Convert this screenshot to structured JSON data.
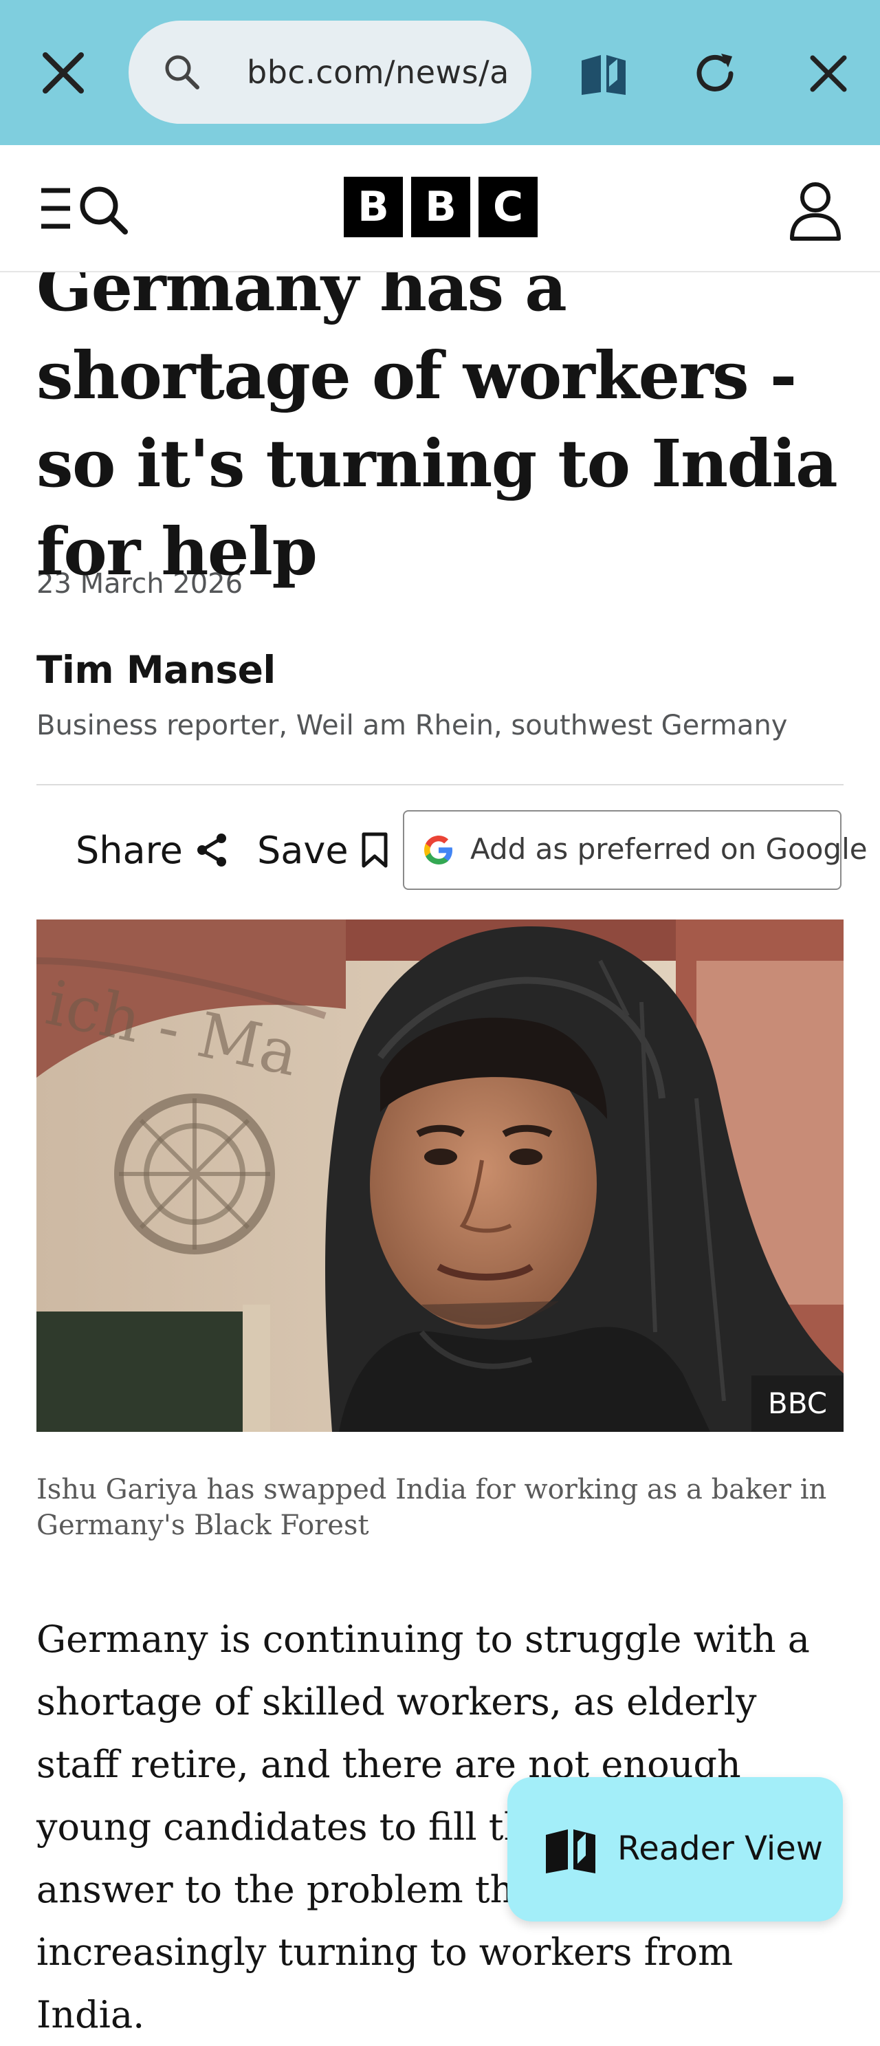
{
  "browser": {
    "url": "bbc.com/news/a",
    "icons": [
      "close-icon",
      "search-icon",
      "reader-mode-icon",
      "reload-icon",
      "close-icon"
    ]
  },
  "header": {
    "logo_letters": [
      "B",
      "B",
      "C"
    ],
    "icons": [
      "menu-search-icon",
      "account-icon"
    ]
  },
  "article": {
    "headline": "Germany has a shortage of workers - so it's turning to India for help",
    "date": "23 March 2026",
    "author": "Tim Mansel",
    "author_role": "Business reporter, Weil am Rhein, southwest Germany",
    "share_label": "Share",
    "save_label": "Save",
    "google_label": "Add as preferred on Google",
    "image_credit": "BBC",
    "caption": "Ishu Gariya has swapped India for working as a baker in Germany's Black Forest",
    "body": "Germany is continuing to struggle with a shortage of skilled workers, as elderly staff retire, and there are not enough young candidates to fill their roles. One answer to the problem the country is increasingly turning to workers from India."
  },
  "fab": {
    "label": "Reader View",
    "icon": "reader-mode-icon"
  },
  "colors": {
    "browser_bar": "#7fcede",
    "fab": "#a3eef9",
    "logo": "#000000"
  }
}
